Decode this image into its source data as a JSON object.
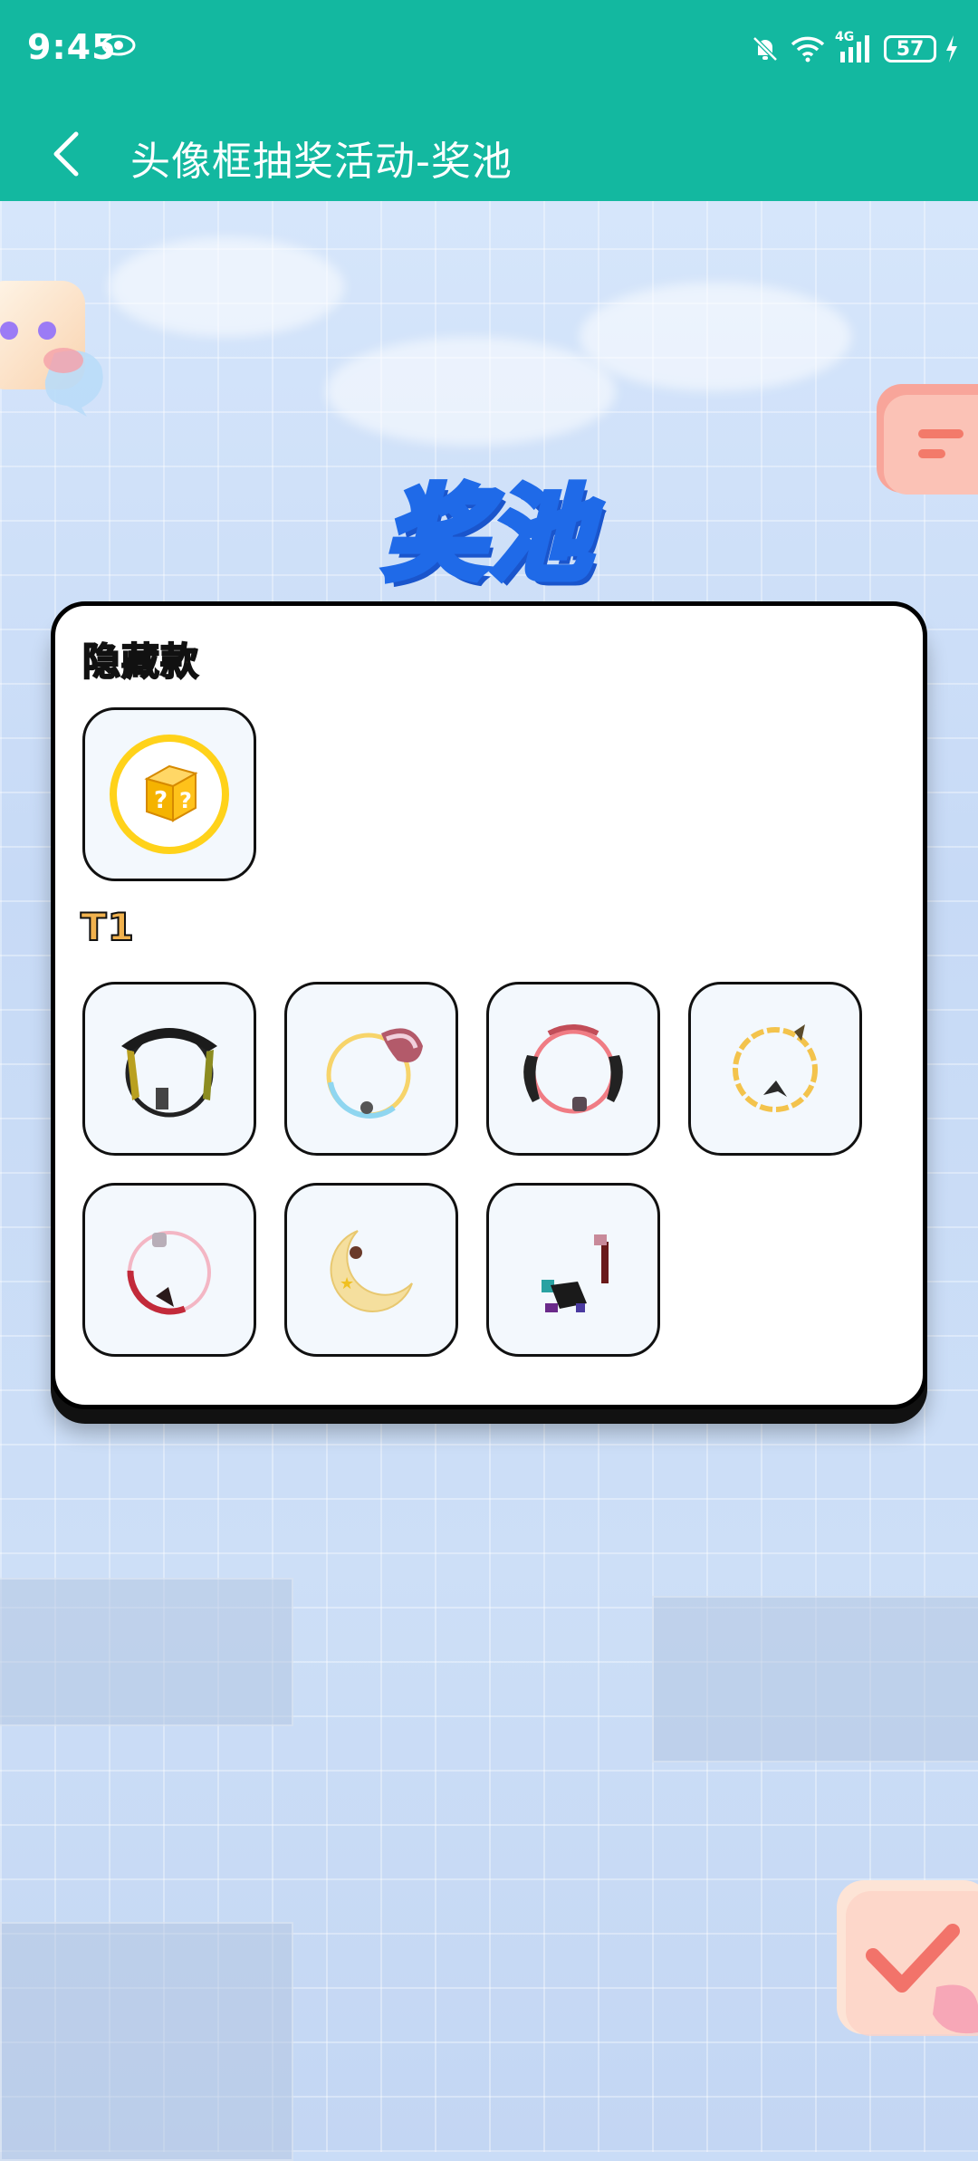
{
  "status_bar": {
    "time": "9:45",
    "network": "4G",
    "battery": "57"
  },
  "app_bar": {
    "title": "头像框抽奖活动-奖池"
  },
  "banner": {
    "title": "奖池"
  },
  "sections": [
    {
      "label": "隐藏款",
      "items": [
        "mystery-box"
      ]
    },
    {
      "label": "T1",
      "items": [
        "frame-1",
        "frame-2",
        "frame-3",
        "frame-4",
        "frame-5",
        "frame-6",
        "frame-7"
      ]
    }
  ],
  "colors": {
    "header": "#13b8a0",
    "section_label": "#f1b24e",
    "title_stroke": "#1f6ae8"
  }
}
